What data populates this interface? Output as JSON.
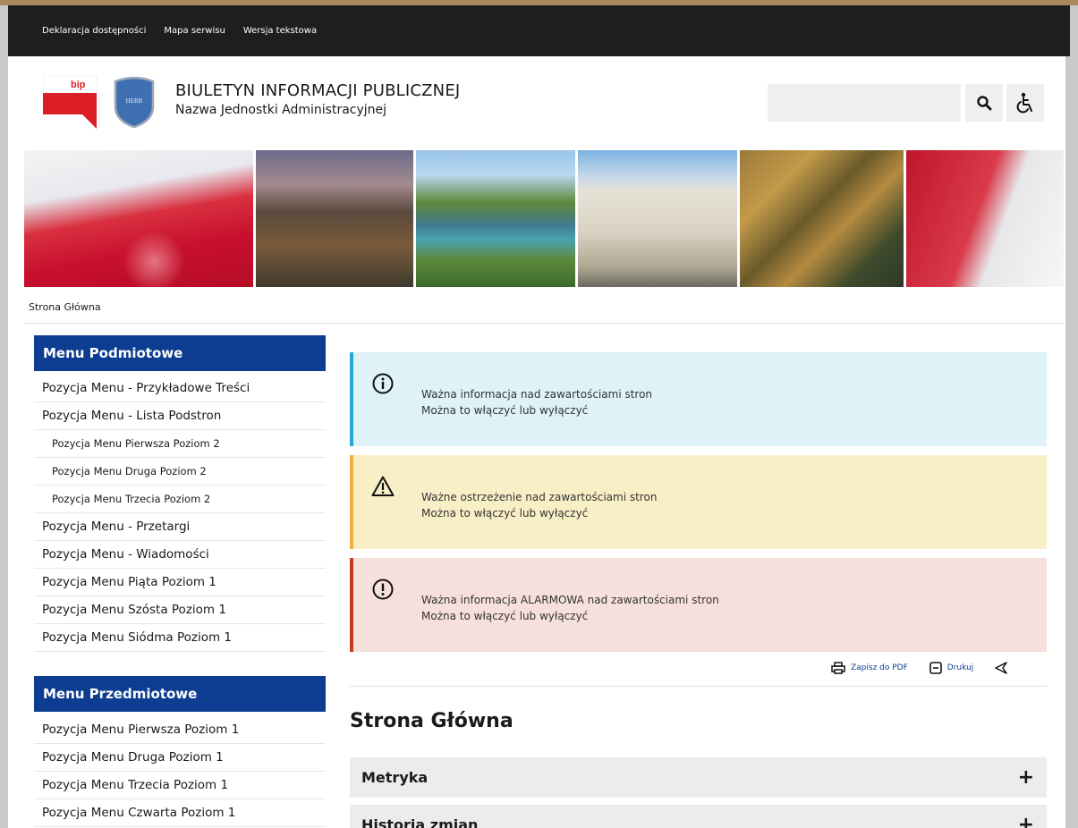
{
  "topbar": {
    "links": [
      "Deklaracja dostępności",
      "Mapa serwisu",
      "Wersja tekstowa"
    ]
  },
  "header": {
    "logo_text": "bip",
    "crest_text": "HERB",
    "title": "BIULETYN INFORMACJI PUBLICZNEJ",
    "subtitle": "Nazwa Jednostki Administracyjnej"
  },
  "search": {
    "value": "",
    "placeholder": ""
  },
  "breadcrumb": "Strona Główna",
  "menu_podmiotowe": {
    "title": "Menu Podmiotowe",
    "items": [
      "Pozycja Menu - Przykładowe Treści",
      "Pozycja Menu - Lista Podstron",
      "Pozycja Menu Pierwsza Poziom 2",
      "Pozycja Menu Druga Poziom 2",
      "Pozycja Menu Trzecia Poziom 2",
      "Pozycja Menu - Przetargi",
      "Pozycja Menu - Wiadomości",
      "Pozycja Menu Piąta Poziom 1",
      "Pozycja Menu Szósta Poziom 1",
      "Pozycja Menu Siódma Poziom 1"
    ]
  },
  "menu_przedmiotowe": {
    "title": "Menu Przedmiotowe",
    "items": [
      "Pozycja Menu Pierwsza Poziom 1",
      "Pozycja Menu Druga Poziom 1",
      "Pozycja Menu Trzecia Poziom 1",
      "Pozycja Menu Czwarta Poziom 1"
    ]
  },
  "alerts": {
    "info": {
      "line1": "Ważna informacja nad zawartościami stron",
      "line2": "Można to włączyć lub wyłączyć"
    },
    "warning": {
      "line1": "Ważne ostrzeżenie nad zawartościami stron",
      "line2": "Można to włączyć lub wyłączyć"
    },
    "alarm": {
      "line1": "Ważna informacja ALARMOWA nad zawartościami stron",
      "line2": "Można to włączyć lub wyłączyć"
    }
  },
  "tools": {
    "pdf": "Zapisz do PDF",
    "print": "Drukuj"
  },
  "content": {
    "heading": "Strona Główna",
    "accordions": [
      "Metryka",
      "Historia zmian"
    ]
  },
  "colors": {
    "menu_header": "#0d3d91",
    "info_border": "#22a9d6",
    "warning_border": "#f0b23b",
    "alarm_border": "#c63a22"
  }
}
